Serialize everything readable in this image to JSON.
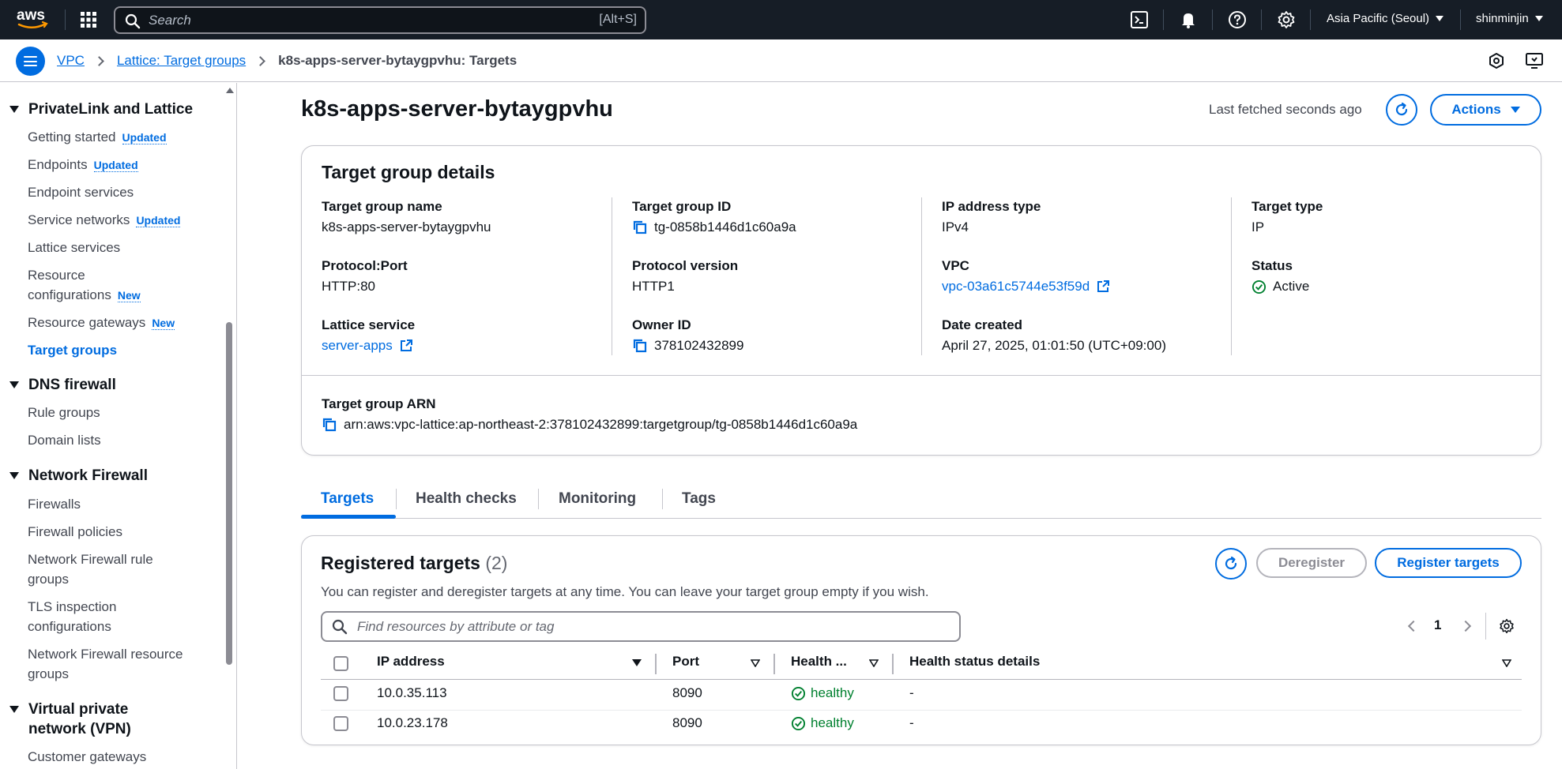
{
  "topnav": {
    "search_placeholder": "Search",
    "search_shortcut": "[Alt+S]",
    "region": "Asia Pacific (Seoul)",
    "user": "shinminjin",
    "bg_color": "#161d26"
  },
  "breadcrumb": {
    "items": [
      "VPC",
      "Lattice: Target groups"
    ],
    "current": "k8s-apps-server-bytaygpvhu: Targets"
  },
  "sidebar": {
    "sections": [
      {
        "title": "PrivateLink and Lattice",
        "items": [
          {
            "label": "Getting started",
            "badge": "Updated"
          },
          {
            "label": "Endpoints",
            "badge": "Updated"
          },
          {
            "label": "Endpoint services"
          },
          {
            "label": "Service networks",
            "badge": "Updated"
          },
          {
            "label": "Lattice services"
          },
          {
            "label": "Resource configurations",
            "badge": "New"
          },
          {
            "label": "Resource gateways",
            "badge": "New"
          },
          {
            "label": "Target groups",
            "active": true
          }
        ]
      },
      {
        "title": "DNS firewall",
        "items": [
          {
            "label": "Rule groups"
          },
          {
            "label": "Domain lists"
          }
        ]
      },
      {
        "title": "Network Firewall",
        "items": [
          {
            "label": "Firewalls"
          },
          {
            "label": "Firewall policies"
          },
          {
            "label": "Network Firewall rule groups"
          },
          {
            "label": "TLS inspection configurations"
          },
          {
            "label": "Network Firewall resource groups"
          }
        ]
      },
      {
        "title": "Virtual private network (VPN)",
        "items": [
          {
            "label": "Customer gateways"
          }
        ]
      }
    ]
  },
  "header": {
    "title": "k8s-apps-server-bytaygpvhu",
    "last_fetched": "Last fetched seconds ago",
    "actions_label": "Actions"
  },
  "details": {
    "title": "Target group details",
    "fields": {
      "name": {
        "label": "Target group name",
        "value": "k8s-apps-server-bytaygpvhu"
      },
      "id": {
        "label": "Target group ID",
        "value": "tg-0858b1446d1c60a9a"
      },
      "ip_type": {
        "label": "IP address type",
        "value": "IPv4"
      },
      "target_type": {
        "label": "Target type",
        "value": "IP"
      },
      "protocol_port": {
        "label": "Protocol:Port",
        "value": "HTTP:80"
      },
      "protocol_version": {
        "label": "Protocol version",
        "value": "HTTP1"
      },
      "vpc": {
        "label": "VPC",
        "value": "vpc-03a61c5744e53f59d"
      },
      "status": {
        "label": "Status",
        "value": "Active"
      },
      "lattice_service": {
        "label": "Lattice service",
        "value": "server-apps"
      },
      "owner_id": {
        "label": "Owner ID",
        "value": "378102432899"
      },
      "date_created": {
        "label": "Date created",
        "value": "April 27, 2025, 01:01:50 (UTC+09:00)"
      },
      "arn": {
        "label": "Target group ARN",
        "value": "arn:aws:vpc-lattice:ap-northeast-2:378102432899:targetgroup/tg-0858b1446d1c60a9a"
      }
    }
  },
  "tabs": [
    "Targets",
    "Health checks",
    "Monitoring",
    "Tags"
  ],
  "targets": {
    "title": "Registered targets",
    "count": "(2)",
    "description": "You can register and deregister targets at any time. You can leave your target group empty if you wish.",
    "deregister_label": "Deregister",
    "register_label": "Register targets",
    "filter_placeholder": "Find resources by attribute or tag",
    "page": "1",
    "columns": [
      "IP address",
      "Port",
      "Health ...",
      "Health status details"
    ],
    "rows": [
      {
        "ip": "10.0.35.113",
        "port": "8090",
        "health": "healthy",
        "details": "-"
      },
      {
        "ip": "10.0.23.178",
        "port": "8090",
        "health": "healthy",
        "details": "-"
      }
    ]
  },
  "colors": {
    "accent": "#006ce0",
    "success": "#00802f",
    "text": "#0f141a",
    "muted": "#424650"
  },
  "icons": [
    "aws-logo",
    "apps-grid-icon",
    "search-icon",
    "cloudshell-icon",
    "bell-icon",
    "help-icon",
    "gear-icon",
    "hamburger-icon",
    "security-hexagon-icon",
    "feedback-icon",
    "refresh-icon",
    "copy-icon",
    "external-link-icon",
    "check-circle-icon",
    "settings-icon"
  ]
}
